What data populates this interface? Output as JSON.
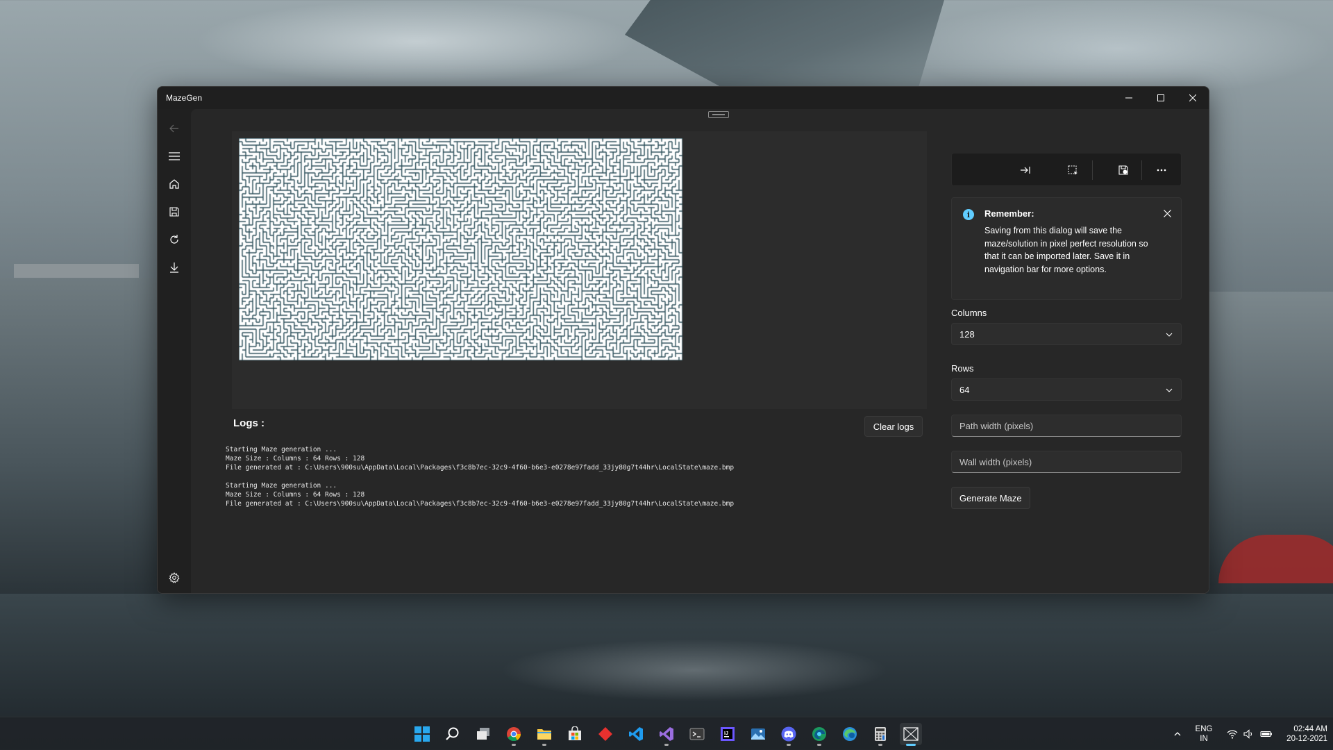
{
  "window": {
    "title": "MazeGen",
    "minimize_icon": "minimize-icon",
    "maximize_icon": "maximize-icon",
    "close_icon": "close-icon"
  },
  "nav": {
    "items": [
      {
        "name": "back",
        "icon": "back-arrow-icon"
      },
      {
        "name": "menu",
        "icon": "hamburger-icon"
      },
      {
        "name": "home",
        "icon": "home-icon"
      },
      {
        "name": "save",
        "icon": "save-icon"
      },
      {
        "name": "refresh",
        "icon": "refresh-icon"
      },
      {
        "name": "download",
        "icon": "download-icon"
      },
      {
        "name": "settings",
        "icon": "gear-icon"
      }
    ]
  },
  "maze": {
    "columns": 128,
    "rows": 64,
    "wall_color": "#2c4f5a",
    "path_color": "#ffffff"
  },
  "logs": {
    "title": "Logs :",
    "clear_label": "Clear logs",
    "entries": [
      {
        "line1": "Starting Maze generation ...",
        "line2": "Maze Size : Columns : 64 Rows : 128",
        "line3": "File generated at : C:\\Users\\900su\\AppData\\Local\\Packages\\f3c8b7ec-32c9-4f60-b6e3-e0278e97fadd_33jy80g7t44hr\\LocalState\\maze.bmp"
      },
      {
        "line1": "Starting Maze generation ...",
        "line2": "Maze Size : Columns : 64 Rows : 128",
        "line3": "File generated at : C:\\Users\\900su\\AppData\\Local\\Packages\\f3c8b7ec-32c9-4f60-b6e3-e0278e97fadd_33jy80g7t44hr\\LocalState\\maze.bmp"
      }
    ]
  },
  "commandbar": {
    "icons": [
      "tab-right-icon",
      "select-region-icon",
      "save-settings-icon",
      "more-icon"
    ]
  },
  "infobar": {
    "title": "Remember:",
    "message": "Saving from this dialog will save the maze/solution in pixel perfect resolution so that it can be imported later. Save it in navigation bar for more options.",
    "icon": "info-icon"
  },
  "form": {
    "columns_label": "Columns",
    "columns_value": "128",
    "rows_label": "Rows",
    "rows_value": "64",
    "path_width_placeholder": "Path width (pixels)",
    "wall_width_placeholder": "Wall width (pixels)",
    "generate_label": "Generate Maze"
  },
  "taskbar": {
    "apps": [
      "windows-start-icon",
      "search-icon",
      "task-view-icon",
      "chrome-icon",
      "file-explorer-icon",
      "microsoft-store-icon",
      "git-icon",
      "vscode-icon",
      "visual-studio-icon",
      "terminal-icon",
      "jetbrains-icon",
      "photos-icon",
      "discord-icon",
      "edge-dev-icon",
      "edge-beta-icon",
      "calculator-icon",
      "mazegen-icon"
    ],
    "language_line1": "ENG",
    "language_line2": "IN",
    "time": "02:44 AM",
    "date": "20-12-2021"
  },
  "colors": {
    "accent": "#60cdff",
    "window_bg": "#202020",
    "content_bg": "#272727"
  }
}
